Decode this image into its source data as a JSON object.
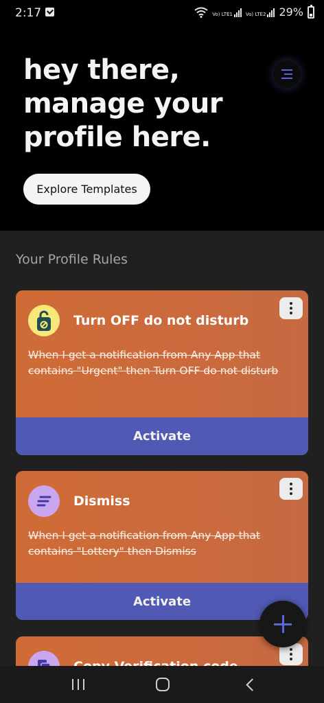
{
  "status_bar": {
    "time": "2:17",
    "sim1_label": "Vo) LTE1",
    "sim2_label": "Vo) LTE2",
    "battery_percent": "29%"
  },
  "hero": {
    "title": "hey there, manage your profile here.",
    "explore_button_label": "Explore Templates"
  },
  "section_title": "Your Profile Rules",
  "rules": [
    {
      "title": "Turn OFF do not disturb",
      "description": "When I get a notification from Any App that contains \"Urgent\" then Turn OFF do not disturb",
      "action_label": "Activate",
      "icon": "do-not-disturb-hanger-icon",
      "icon_bg": "#f7e77a"
    },
    {
      "title": "Dismiss",
      "description": "When I get a notification from Any App that contains \"Lottery\" then Dismiss",
      "action_label": "Activate",
      "icon": "dismiss-lines-icon",
      "icon_bg": "#c9a6ee"
    },
    {
      "title": "Copy Verification code",
      "icon": "copy-icon",
      "icon_bg": "#c9a6ee"
    }
  ],
  "colors": {
    "card_orange": "#cf6b36",
    "activate_blue": "#5059b4",
    "accent_blue": "#5b67d8"
  }
}
